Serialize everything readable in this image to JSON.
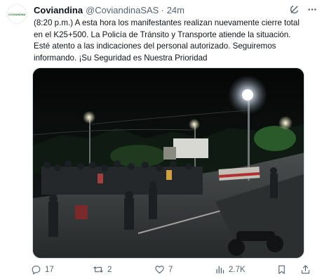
{
  "tweet": {
    "author_name": "Coviandina",
    "handle": "@CoviandinaSAS",
    "separator": "·",
    "time": "24m",
    "avatar_text": "COVIANDINA",
    "text_lines": [
      "(8:20 p.m.) A esta hora los manifestantes realizan nuevamente cierre total",
      "en el K25+500. La Policía de Tránsito y Transporte atiende la situación.",
      "Esté atento a las indicaciones del personal autorizado. Seguiremos",
      "informando. ¡Su Seguridad es Nuestra Prioridad"
    ]
  },
  "actions": {
    "replies": "17",
    "retweets": "2",
    "likes": "7",
    "views": "2.7K"
  },
  "icons": {
    "grok": "grok-icon",
    "more": "more-icon",
    "reply": "reply-icon",
    "retweet": "retweet-icon",
    "like": "heart-icon",
    "views": "views-icon",
    "bookmark": "bookmark-icon",
    "share": "share-icon"
  },
  "colors": {
    "text": "#0f1419",
    "muted": "#536471",
    "border": "#cfd9de"
  }
}
